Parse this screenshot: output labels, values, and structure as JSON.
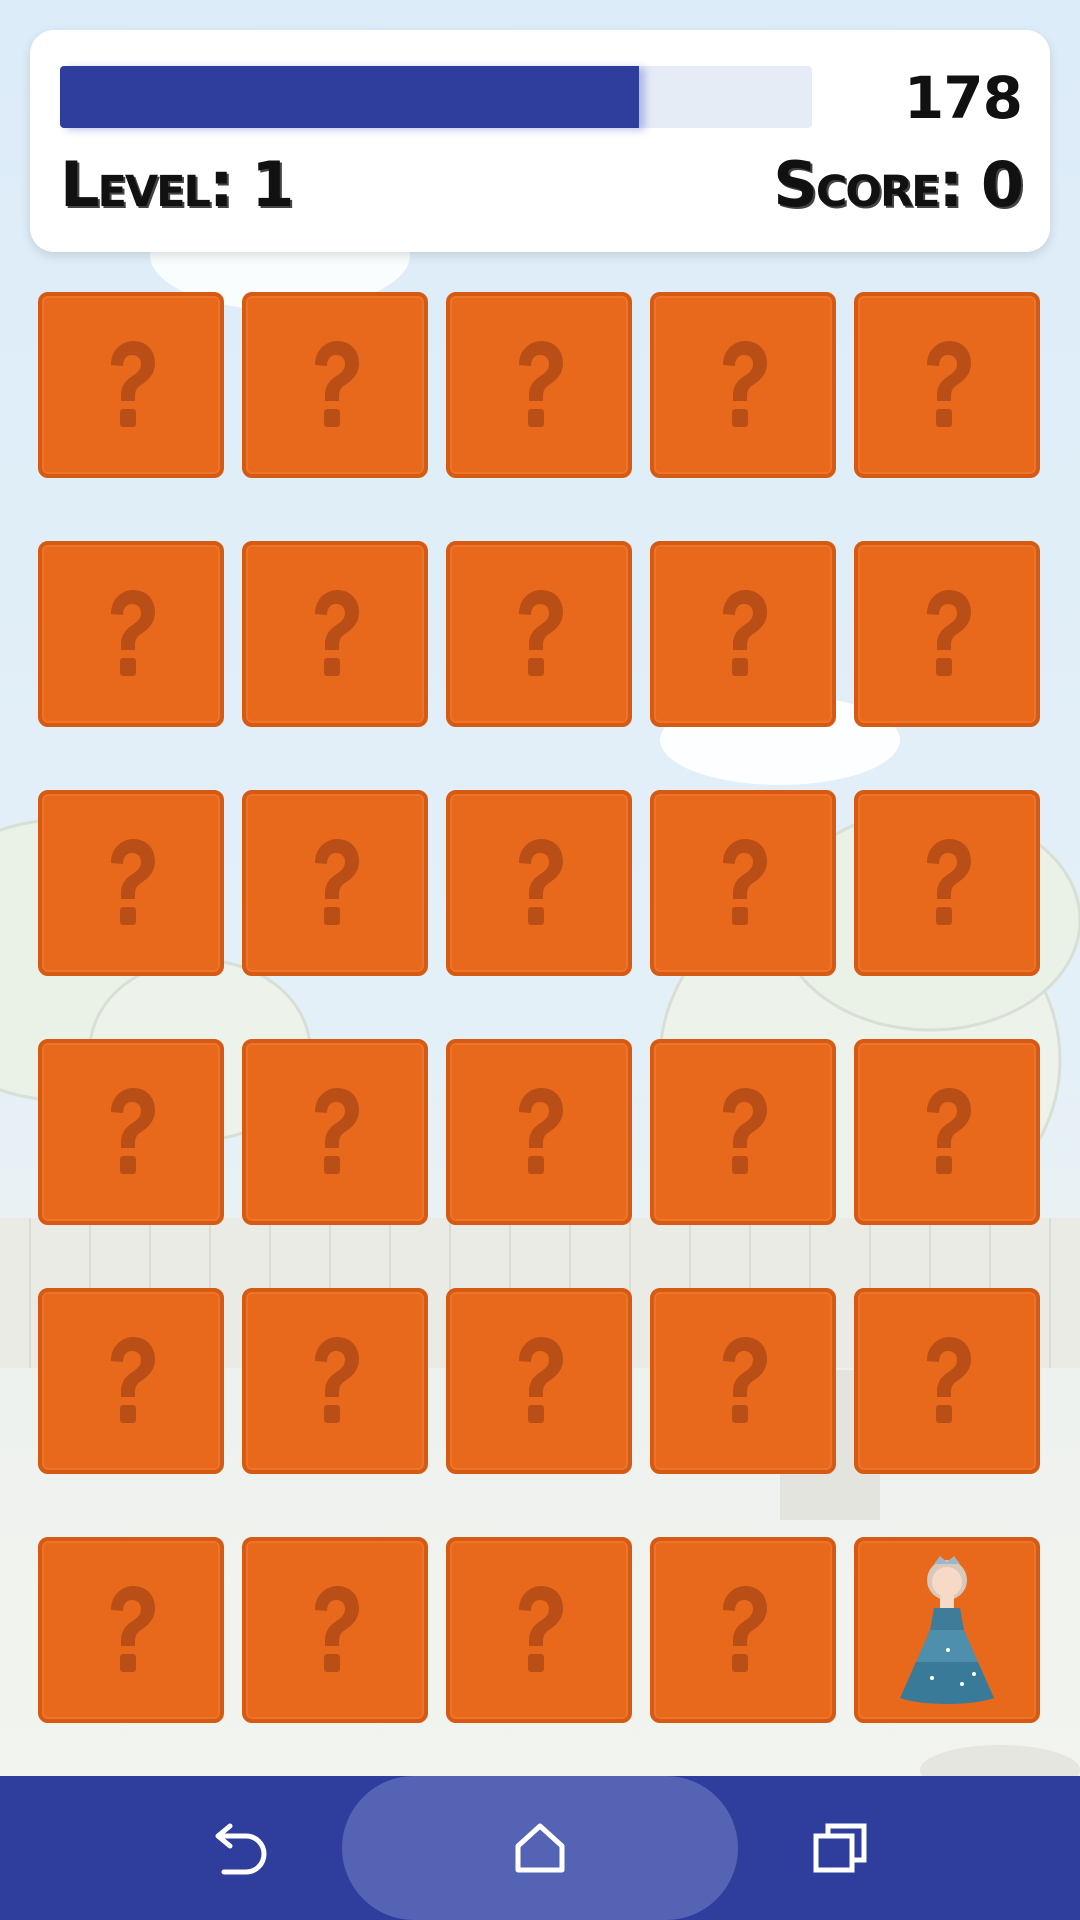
{
  "hud": {
    "timer_value": "178",
    "timer_fraction": 0.77,
    "level_label": "Level: 1",
    "score_label": "Score: 0"
  },
  "board": {
    "rows": 6,
    "cols": 5,
    "revealed_card": {
      "row": 6,
      "col": 5,
      "icon": "princess-icon"
    },
    "hidden_card_icon": "question-mark-icon"
  },
  "colors": {
    "card": "#e8681c",
    "card_border": "#d55a14",
    "question_mark": "#b94f16",
    "timer_fill": "#2f3d9c",
    "navbar": "#2f3d9c"
  },
  "navbar": {
    "back_icon": "back-icon",
    "home_icon": "home-icon",
    "recents_icon": "recents-icon"
  }
}
